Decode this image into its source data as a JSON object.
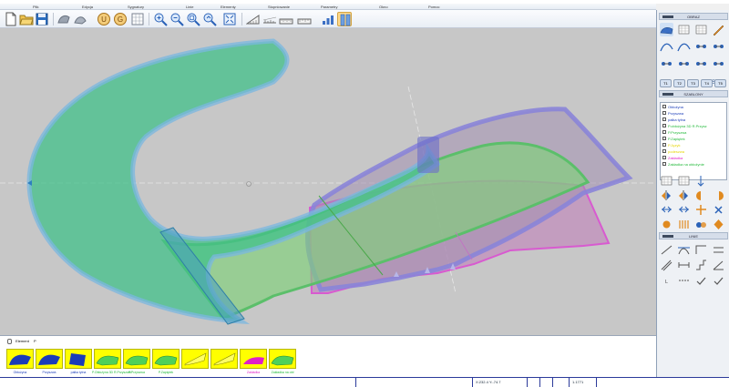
{
  "menu": {
    "items": [
      {
        "label": "Plik"
      },
      {
        "label": "Edycja"
      },
      {
        "label": "Sygnatury"
      },
      {
        "label": "Linie"
      },
      {
        "label": "Elementy"
      },
      {
        "label": "Stopniowanie"
      },
      {
        "label": "Parametry"
      },
      {
        "label": "Okno"
      },
      {
        "label": "Pomoc"
      }
    ]
  },
  "toolbar": {
    "buttons": [
      {
        "icon": "new-file-icon"
      },
      {
        "icon": "open-folder-icon"
      },
      {
        "icon": "save-icon"
      },
      {
        "icon": "undo-shape-icon"
      },
      {
        "icon": "redo-shape-icon"
      },
      {
        "icon": "coin-u-icon",
        "text": "U"
      },
      {
        "icon": "coin-g-icon",
        "text": "G"
      },
      {
        "icon": "grid-icon"
      },
      {
        "icon": "zoom-in-icon"
      },
      {
        "icon": "zoom-out-icon"
      },
      {
        "icon": "zoom-window-icon"
      },
      {
        "icon": "zoom-previous-icon"
      },
      {
        "icon": "fit-all-icon"
      },
      {
        "icon": "ruler-icon"
      },
      {
        "icon": "scale-icon"
      },
      {
        "icon": "measure-icon"
      },
      {
        "icon": "bars-icon"
      },
      {
        "icon": "layers-icon"
      }
    ]
  },
  "right_panel": {
    "obraz_title": "OBRAZ",
    "szablony_title": "SZABLONY",
    "linie_title": "LINIE",
    "layers": [
      {
        "label": "Obłożyna",
        "color": "#1a3cb8"
      },
      {
        "label": "Przyszwa",
        "color": "#1a3cb8"
      },
      {
        "label": "pałka tylna",
        "color": "#1a3cb8"
      },
      {
        "label": "P.obłożyna 3D R.Przysz",
        "color": "#22b93a"
      },
      {
        "label": "P.Przyszwa",
        "color": "#22b93a"
      },
      {
        "label": "P.Zapiętek",
        "color": "#22b93a"
      },
      {
        "label": "P.Język",
        "color": "#e6d600"
      },
      {
        "label": "podeszwa",
        "color": "#e6d600"
      },
      {
        "label": "Zakładka",
        "color": "#e020c8"
      },
      {
        "label": "Zakładka na obłożynie",
        "color": "#22b93a"
      }
    ],
    "tt_buttons": [
      "T1",
      "T2",
      "T3",
      "T4",
      "T5"
    ],
    "spp_label": "SPPs"
  },
  "bottom": {
    "tab_label": "Element",
    "tab_suffix": "P",
    "elements": [
      {
        "label": "Obłożyna",
        "color": "#1a3cb8",
        "shape": "blue"
      },
      {
        "label": "Przyszwa",
        "color": "#1a3cb8",
        "shape": "blue"
      },
      {
        "label": "pałka tylna",
        "color": "#1a3cb8",
        "shape": "blue-rect"
      },
      {
        "label": "P.Obłożyna 3D R.Przyszwa",
        "color": "#22b93a",
        "shape": "green"
      },
      {
        "label": "P.Przyszwa",
        "color": "#22b93a",
        "shape": "green"
      },
      {
        "label": "P.Zapiętek",
        "color": "#22b93a",
        "shape": "green"
      },
      {
        "label": "",
        "color": "#c9c900",
        "shape": "yellow"
      },
      {
        "label": "",
        "color": "#c9c900",
        "shape": "yellow"
      },
      {
        "label": "Zakładka",
        "color": "#e020c8",
        "shape": "pink"
      },
      {
        "label": "Zakładka na obł",
        "color": "#22b93a",
        "shape": "green"
      }
    ]
  },
  "status": {
    "coords": "X:232.4 Y:-74.7",
    "scale": "1.1771"
  },
  "colors": {
    "canvas_bg": "#c7c7c7",
    "green_fill": "#4fcf84",
    "purple_outline": "#8a84d8",
    "pink_fill": "#c07ab8"
  }
}
